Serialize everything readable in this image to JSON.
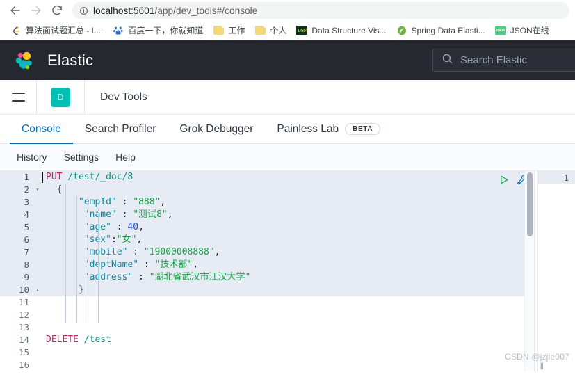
{
  "browser": {
    "back_icon": "arrow-left-icon",
    "forward_icon": "arrow-right-icon",
    "reload_icon": "reload-icon",
    "info_icon": "info-circle-icon",
    "url_host": "localhost:5601",
    "url_path": "/app/dev_tools#/console",
    "url_full": "localhost:5601/app/dev_tools#/console"
  },
  "bookmarks": [
    {
      "icon": "leetcode-icon",
      "label": "算法面试题汇总 - L..."
    },
    {
      "icon": "baidu-icon",
      "label": "百度一下，你就知道"
    },
    {
      "icon": "folder-icon",
      "label": "工作"
    },
    {
      "icon": "folder-icon",
      "label": "个人"
    },
    {
      "icon": "usf-icon",
      "label": "Data Structure Vis..."
    },
    {
      "icon": "spring-icon",
      "label": "Spring Data Elasti..."
    },
    {
      "icon": "json-icon",
      "label": "JSON在线"
    }
  ],
  "elastic_header": {
    "logo_icon": "elastic-logo-icon",
    "title": "Elastic",
    "search_icon": "search-icon",
    "search_placeholder": "Search Elastic",
    "bg_color": "#25282f"
  },
  "breadcrumb": {
    "menu_icon": "hamburger-menu-icon",
    "app_initial": "D",
    "app_badge_color": "#00bfb3",
    "title": "Dev Tools"
  },
  "tabs": [
    {
      "label": "Console",
      "active": true
    },
    {
      "label": "Search Profiler",
      "active": false
    },
    {
      "label": "Grok Debugger",
      "active": false
    },
    {
      "label": "Painless Lab",
      "active": false,
      "badge": "BETA"
    }
  ],
  "submenu": [
    {
      "label": "History"
    },
    {
      "label": "Settings"
    },
    {
      "label": "Help"
    }
  ],
  "editor": {
    "play_icon": "play-triangle-icon",
    "wrench_icon": "wrench-icon",
    "accent_color": "#0071c2",
    "lines": [
      {
        "n": "1",
        "fold": "",
        "hl": true,
        "cursor": true,
        "tokens": [
          {
            "t": "method",
            "v": "PUT"
          },
          {
            "t": "punc",
            "v": " "
          },
          {
            "t": "url",
            "v": "/test/_doc/8"
          }
        ]
      },
      {
        "n": "2",
        "fold": "▾",
        "hl": true,
        "tokens": [
          {
            "t": "punc",
            "v": "  "
          },
          {
            "t": "brace",
            "v": "{"
          }
        ]
      },
      {
        "n": "3",
        "fold": "",
        "hl": true,
        "tokens": [
          {
            "t": "punc",
            "v": "      "
          },
          {
            "t": "key",
            "v": "\"empId\""
          },
          {
            "t": "punc",
            "v": " : "
          },
          {
            "t": "str",
            "v": "\"888\""
          },
          {
            "t": "punc",
            "v": ","
          }
        ]
      },
      {
        "n": "4",
        "fold": "",
        "hl": true,
        "tokens": [
          {
            "t": "punc",
            "v": "       "
          },
          {
            "t": "key",
            "v": "\"name\""
          },
          {
            "t": "punc",
            "v": " : "
          },
          {
            "t": "str",
            "v": "\"测试8\""
          },
          {
            "t": "punc",
            "v": ","
          }
        ]
      },
      {
        "n": "5",
        "fold": "",
        "hl": true,
        "tokens": [
          {
            "t": "punc",
            "v": "       "
          },
          {
            "t": "key",
            "v": "\"age\""
          },
          {
            "t": "punc",
            "v": " : "
          },
          {
            "t": "num",
            "v": "40"
          },
          {
            "t": "punc",
            "v": ","
          }
        ]
      },
      {
        "n": "6",
        "fold": "",
        "hl": true,
        "tokens": [
          {
            "t": "punc",
            "v": "       "
          },
          {
            "t": "key",
            "v": "\"sex\""
          },
          {
            "t": "punc",
            "v": ":"
          },
          {
            "t": "str",
            "v": "\"女\""
          },
          {
            "t": "punc",
            "v": ","
          }
        ]
      },
      {
        "n": "7",
        "fold": "",
        "hl": true,
        "tokens": [
          {
            "t": "punc",
            "v": "       "
          },
          {
            "t": "key",
            "v": "\"mobile\""
          },
          {
            "t": "punc",
            "v": " : "
          },
          {
            "t": "str",
            "v": "\"19000008888\""
          },
          {
            "t": "punc",
            "v": ","
          }
        ]
      },
      {
        "n": "8",
        "fold": "",
        "hl": true,
        "tokens": [
          {
            "t": "punc",
            "v": "       "
          },
          {
            "t": "key",
            "v": "\"deptName\""
          },
          {
            "t": "punc",
            "v": " : "
          },
          {
            "t": "str",
            "v": "\"技术部\""
          },
          {
            "t": "punc",
            "v": ","
          }
        ]
      },
      {
        "n": "9",
        "fold": "",
        "hl": true,
        "tokens": [
          {
            "t": "punc",
            "v": "       "
          },
          {
            "t": "key",
            "v": "\"address\""
          },
          {
            "t": "punc",
            "v": " : "
          },
          {
            "t": "str",
            "v": "\"湖北省武汉市江汉大学\""
          }
        ]
      },
      {
        "n": "10",
        "fold": "▴",
        "hl": true,
        "tokens": [
          {
            "t": "punc",
            "v": "      "
          },
          {
            "t": "brace",
            "v": "}"
          }
        ]
      },
      {
        "n": "11",
        "fold": "",
        "hl": false,
        "tokens": []
      },
      {
        "n": "12",
        "fold": "",
        "hl": false,
        "tokens": []
      },
      {
        "n": "13",
        "fold": "",
        "hl": false,
        "tokens": []
      },
      {
        "n": "14",
        "fold": "",
        "hl": false,
        "tokens": [
          {
            "t": "method",
            "v": "DELETE"
          },
          {
            "t": "punc",
            "v": " "
          },
          {
            "t": "url",
            "v": "/test"
          }
        ]
      },
      {
        "n": "15",
        "fold": "",
        "hl": false,
        "tokens": []
      },
      {
        "n": "16",
        "fold": "",
        "hl": false,
        "tokens": []
      }
    ]
  },
  "response": {
    "lines": [
      {
        "n": "1"
      }
    ]
  },
  "watermark": {
    "text": "CSDN @jzjie007"
  }
}
